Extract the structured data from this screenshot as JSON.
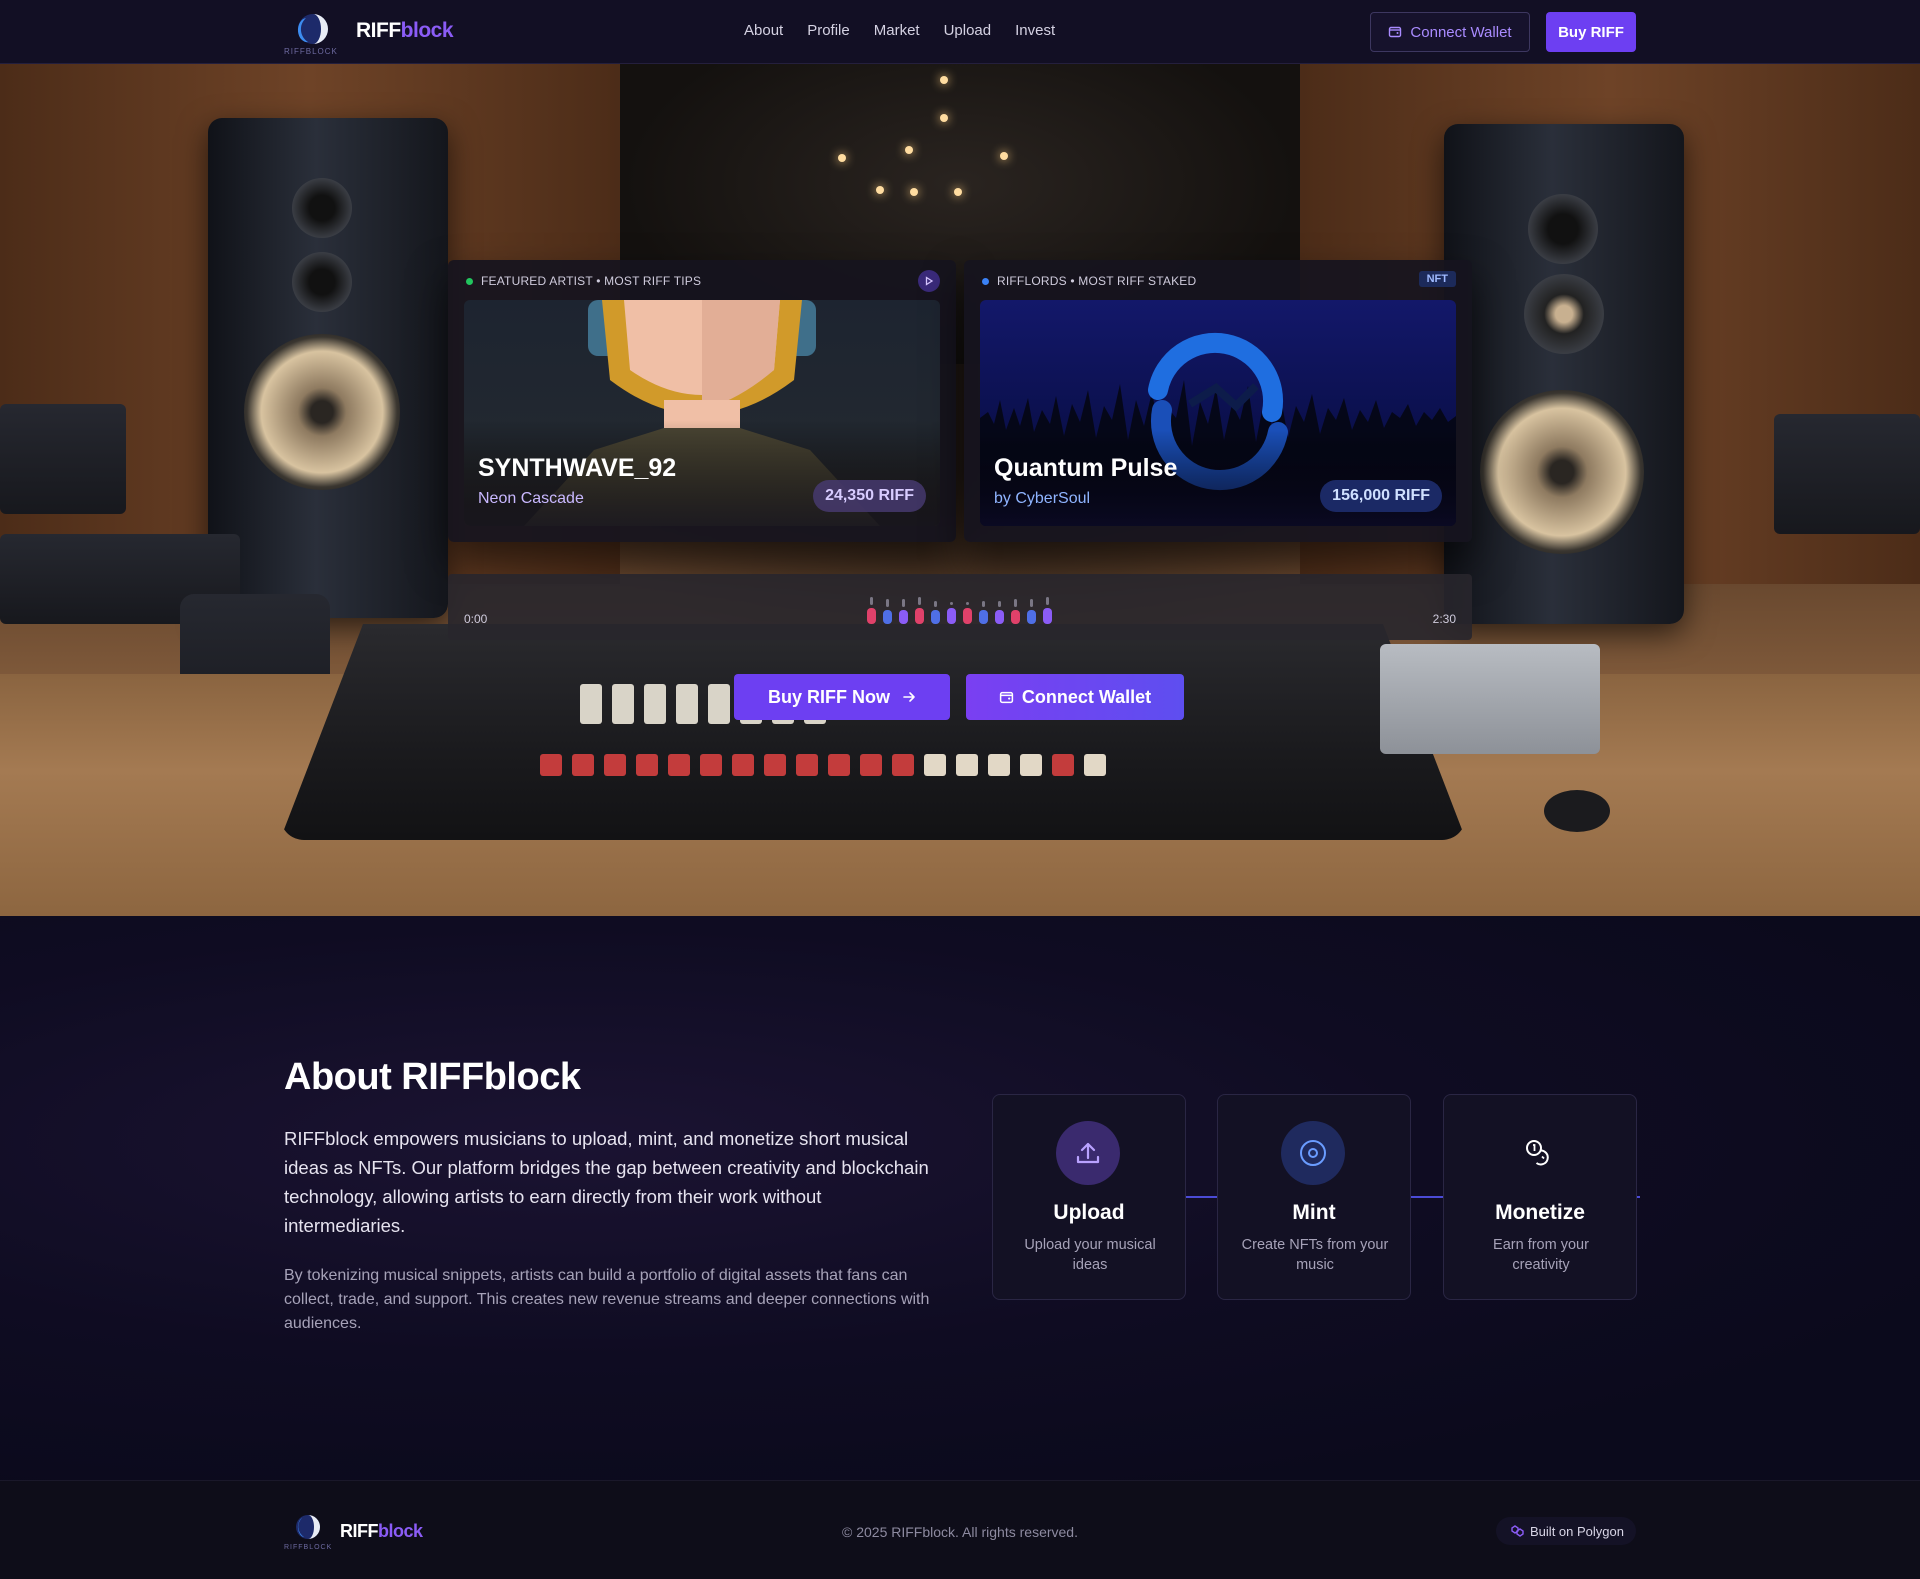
{
  "nav": {
    "brand_main": "RIFF",
    "brand_accent": "block",
    "logo_caption": "RIFFBLOCK",
    "links": [
      "About",
      "Profile",
      "Market",
      "Upload",
      "Invest"
    ],
    "connect_wallet": "Connect Wallet",
    "buy_riff": "Buy RIFF"
  },
  "hero": {
    "featured": {
      "label": "FEATURED ARTIST • MOST RIFF TIPS",
      "artist": "SYNTHWAVE_92",
      "track": "Neon Cascade",
      "amount": "24,350 RIFF",
      "dot_color": "#22c55e"
    },
    "rifflords": {
      "label": "RIFFLORDS • MOST RIFF STAKED",
      "badge": "NFT",
      "title": "Quantum Pulse",
      "by": "by CyberSoul",
      "amount": "156,000 RIFF",
      "dot_color": "#3b82f6"
    },
    "player": {
      "start_time": "0:00",
      "end_time": "2:30"
    },
    "buy_button": "Buy RIFF Now",
    "connect_button": "Connect Wallet"
  },
  "about": {
    "title": "About RIFFblock",
    "p1": "RIFFblock empowers musicians to upload, mint, and monetize short musical ideas as NFTs. Our platform bridges the gap between creativity and blockchain technology, allowing artists to earn directly from their work without intermediaries.",
    "p2": "By tokenizing musical snippets, artists can build a portfolio of digital assets that fans can collect, trade, and support. This creates new revenue streams and deeper connections with audiences.",
    "steps": [
      {
        "title": "Upload",
        "desc": "Upload your musical ideas",
        "icon": "upload-icon"
      },
      {
        "title": "Mint",
        "desc": "Create NFTs from your music",
        "icon": "disc-icon"
      },
      {
        "title": "Monetize",
        "desc": "Earn from your creativity",
        "icon": "coins-icon"
      }
    ]
  },
  "footer": {
    "brand_main": "RIFF",
    "brand_accent": "block",
    "copyright": "© 2025 RIFFblock. All rights reserved.",
    "built_on": "Built on Polygon"
  },
  "colors": {
    "accent": "#8b5cf6",
    "button": "#6d3ff2",
    "background": "#0b0a1c"
  }
}
